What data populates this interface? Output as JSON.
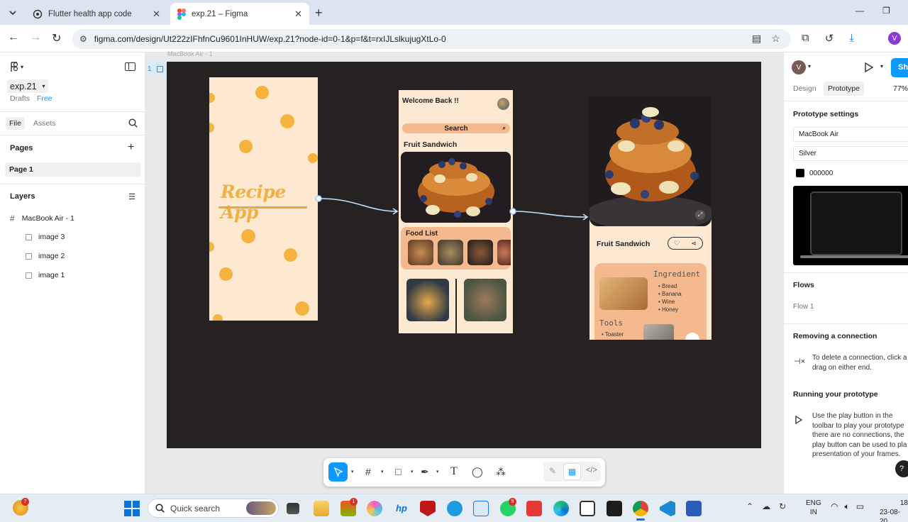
{
  "browser": {
    "tabs": [
      {
        "title": "Flutter health app code"
      },
      {
        "title": "exp.21 – Figma"
      }
    ],
    "url": "figma.com/design/Ut222zIFhfnCu9601InHUW/exp.21?node-id=0-1&p=f&t=rxIJLslkujugXtLo-0",
    "profile_initial": "V"
  },
  "figma_left": {
    "file_name": "exp.21",
    "drafts": "Drafts",
    "plan": "Free",
    "tabs": [
      "File",
      "Assets"
    ],
    "pages_title": "Pages",
    "pages": [
      "Page 1"
    ],
    "layers_title": "Layers",
    "frame_layer": "MacBook Air - 1",
    "layers": [
      "image 3",
      "image 2",
      "image 1"
    ]
  },
  "canvas": {
    "frame_label": "MacBook Air - 1",
    "flow_badge": "1",
    "screen1": {
      "title": "Recipe App"
    },
    "screen2": {
      "welcome": "Welcome Back !!",
      "search": "Search",
      "section1": "Fruit Sandwich",
      "section2": "Food List"
    },
    "screen3": {
      "title": "Fruit Sandwich",
      "ingredient_title": "Ingredient",
      "ingredients": [
        "Bread",
        "Banana",
        "Wine",
        "Honey"
      ],
      "tools_title": "Tools",
      "tools": [
        "Toaster"
      ]
    }
  },
  "figma_right": {
    "avatar": "V",
    "share": "Sha",
    "tabs": [
      "Design",
      "Prototype"
    ],
    "zoom": "77%",
    "prototype_settings": "Prototype settings",
    "device": "MacBook Air",
    "model": "Silver",
    "background_hex": "000000",
    "flows_title": "Flows",
    "flow_name": "Flow 1",
    "removing_title": "Removing a connection",
    "removing_text": "To delete a connection, click a drag on either end.",
    "running_title": "Running your prototype",
    "running_text": "Use the play button in the toolbar to play your prototype there are no connections, the play button can be used to pla presentation of your frames."
  },
  "taskbar": {
    "search_placeholder": "Quick search",
    "language": "ENG",
    "region": "IN",
    "time": "18",
    "date": "23-08-20",
    "badges": {
      "widgets": "7",
      "store": "1",
      "whatsapp": "9"
    }
  },
  "colors": {
    "accent": "#0d99ff",
    "canvas_frame": "#262222",
    "screen_bg": "#fde9d2",
    "dot": "#f6b33f",
    "peach": "#f5b98f"
  }
}
